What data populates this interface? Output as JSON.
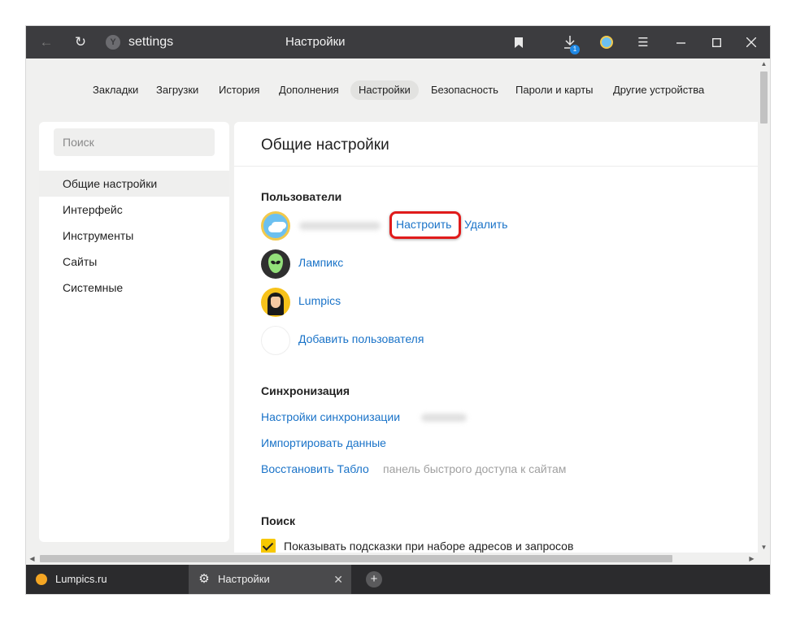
{
  "titlebar": {
    "address": "settings",
    "window_title": "Настройки",
    "download_badge": "1",
    "icons": [
      "back-icon",
      "reload-icon",
      "yandex-icon",
      "bookmark-icon",
      "download-icon",
      "profile-avatar",
      "menu-icon",
      "minimize-icon",
      "maximize-icon",
      "close-icon"
    ]
  },
  "nav_tabs": [
    "Закладки",
    "Загрузки",
    "История",
    "Дополнения",
    "Настройки",
    "Безопасность",
    "Пароли и карты",
    "Другие устройства"
  ],
  "nav_active": "Настройки",
  "sidebar": {
    "search_placeholder": "Поиск",
    "items": [
      "Общие настройки",
      "Интерфейс",
      "Инструменты",
      "Сайты",
      "Системные"
    ],
    "active": "Общие настройки"
  },
  "main": {
    "title": "Общие настройки",
    "users": {
      "heading": "Пользователи",
      "configure": "Настроить",
      "delete": "Удалить",
      "user2": "Лампикс",
      "user3": "Lumpics",
      "add": "Добавить пользователя"
    },
    "sync": {
      "heading": "Синхронизация",
      "settings": "Настройки синхронизации",
      "import": "Импортировать данные",
      "restore": "Восстановить Табло",
      "restore_hint": "панель быстрого доступа к сайтам"
    },
    "search": {
      "heading": "Поиск",
      "show_hints": "Показывать подсказки при наборе адресов и запросов"
    }
  },
  "tabs": [
    {
      "label": "Lumpics.ru",
      "icon": "sun-icon"
    },
    {
      "label": "Настройки",
      "icon": "gear-icon",
      "close": "✕"
    }
  ],
  "colors": {
    "accent_link": "#1a73c8",
    "highlight": "#e01b1b",
    "checkbox": "#f7c800",
    "titlebar": "#3c3c3f"
  }
}
